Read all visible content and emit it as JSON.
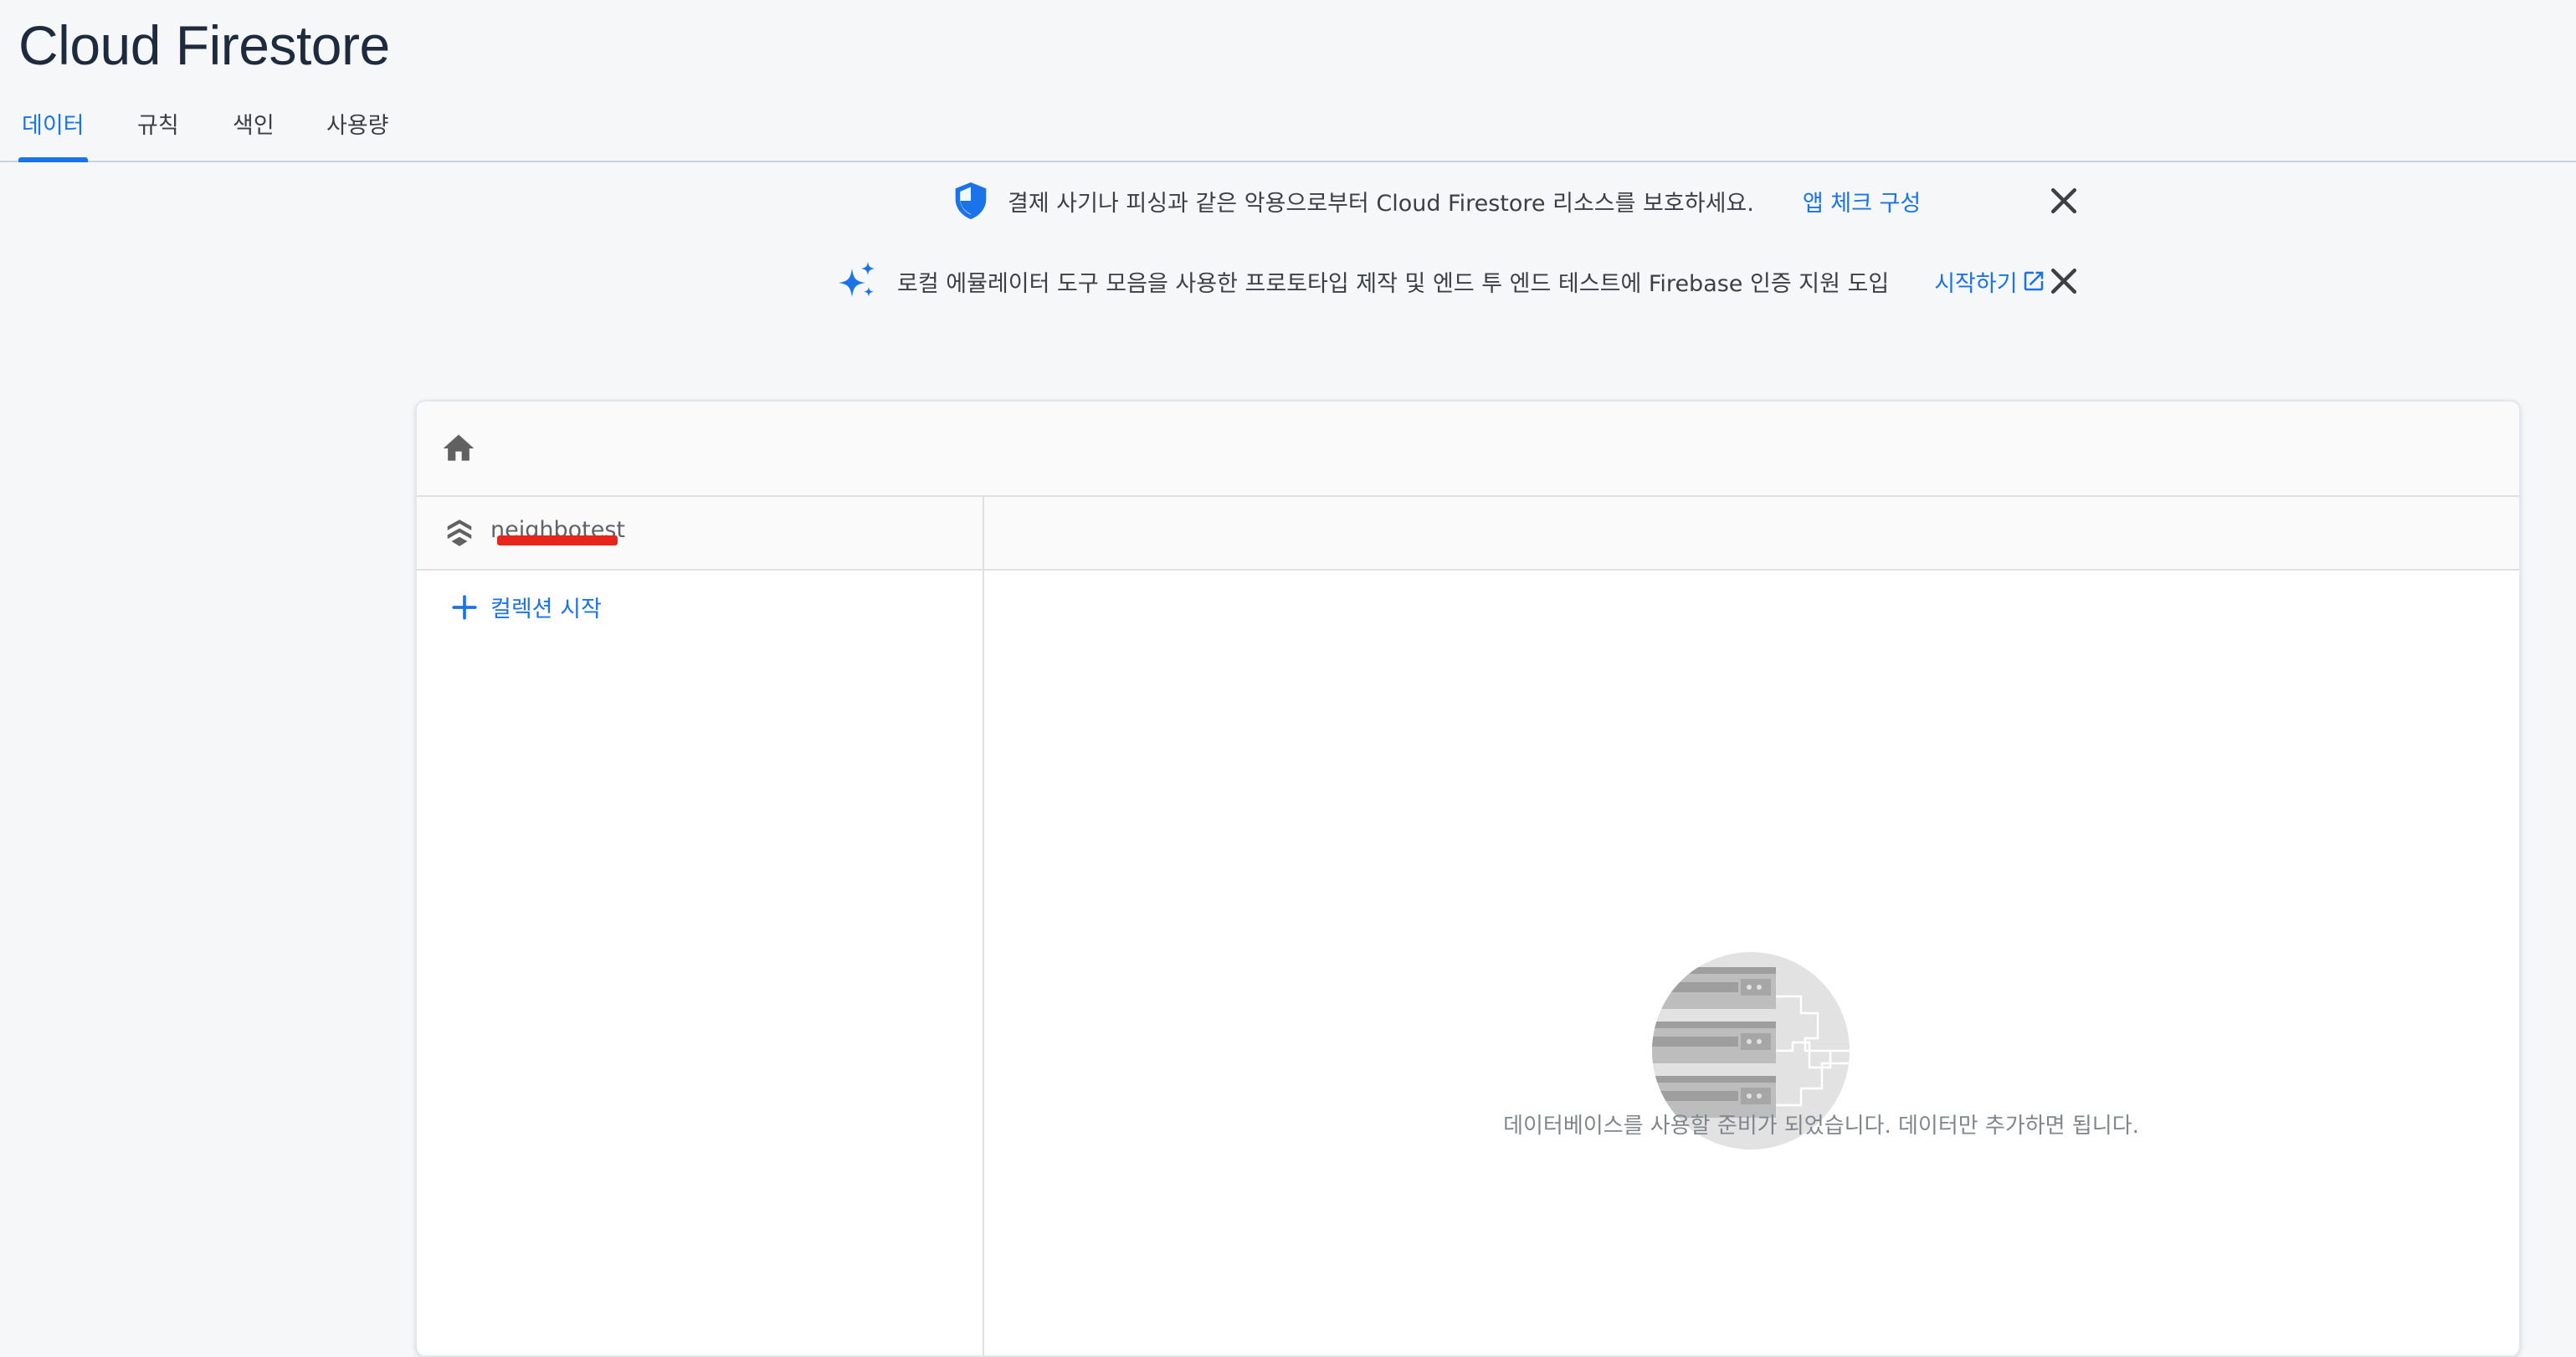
{
  "page": {
    "title": "Cloud Firestore"
  },
  "tabs": [
    {
      "label": "데이터",
      "active": true
    },
    {
      "label": "규칙",
      "active": false
    },
    {
      "label": "색인",
      "active": false
    },
    {
      "label": "사용량",
      "active": false
    }
  ],
  "banners": [
    {
      "icon": "shield-icon",
      "message": "결제 사기나 피싱과 같은 악용으로부터 Cloud Firestore 리소스를 보호하세요.",
      "link": "앱 체크 구성"
    },
    {
      "icon": "sparkle-icon",
      "message": "로컬 에뮬레이터 도구 모음을 사용한 프로토타입 제작 및 엔드 투 엔드 테스트에 Firebase 인증 지원 도입",
      "link": "시작하기"
    }
  ],
  "data_panel": {
    "database_name": "neighbotest",
    "add_collection_label": "컬렉션 시작",
    "empty_message": "데이터베이스를 사용할 준비가 되었습니다. 데이터만 추가하면 됩니다."
  },
  "colors": {
    "accent": "#1a73e8",
    "title": "#1e2a3d",
    "redaction": "#e8251a"
  }
}
